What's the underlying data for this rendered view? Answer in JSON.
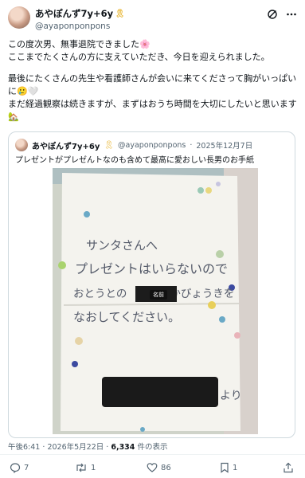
{
  "author": {
    "display_name": "あやぽんず7y+6y",
    "badge": "🎗",
    "handle": "@ayaponponpons"
  },
  "header_icons": {
    "grok": "grok-icon",
    "more": "more-options-icon"
  },
  "tweet": {
    "line1": "この度次男、無事退院できました🌸",
    "line2": "ここまでたくさんの方に支えていただき、今日を迎えられました。",
    "line3": "最後にたくさんの先生や看護師さんが会いに来てくださって胸がいっぱいに🥲🤍",
    "line4": "まだ経過観察は続きますが、まずはおうち時間を大切にしたいと思います🏡"
  },
  "quote": {
    "display_name": "あやぽんず7y+6y",
    "badge": "🎗",
    "handle": "@ayaponponpons",
    "separator": "·",
    "date": "2025年12月7日",
    "text": "プレゼントがプレゼんトなのも含めて最高に愛おしい長男のお手紙",
    "image_label": "名前",
    "letter": {
      "line1": "サンタさんへ",
      "line2": "プレゼントはいらないので",
      "line3": "おとうとの　　　　かびょうきを",
      "line4": "なおしてください。",
      "sign": "より"
    }
  },
  "meta": {
    "time": "午後6:41",
    "dot1": "·",
    "date": "2026年5月22日",
    "dot2": "·",
    "views_count": "6,334",
    "views_label": "件の表示"
  },
  "actions": {
    "reply_count": "7",
    "retweet_count": "1",
    "like_count": "86",
    "bookmark_count": "1"
  },
  "colors": {
    "text": "#0f1419",
    "secondary": "#536471",
    "border": "#cfd9de",
    "badge": "#e8b633"
  }
}
